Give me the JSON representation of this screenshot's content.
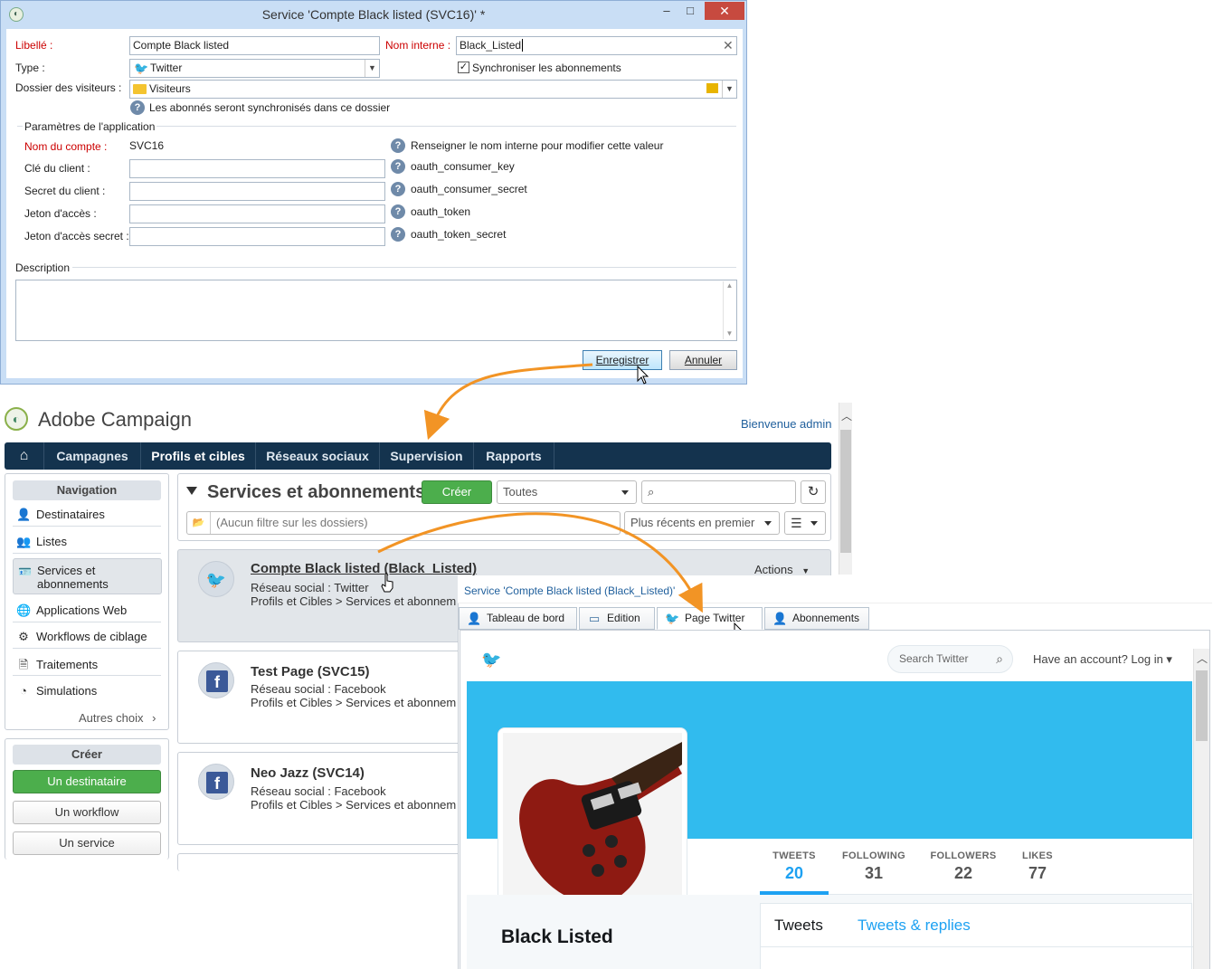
{
  "dialog": {
    "title": "Service 'Compte Black listed (SVC16)' *",
    "win_minimize": "–",
    "win_maximize": "□",
    "win_close": "✕",
    "labels": {
      "libelle": "Libellé :",
      "nom_interne": "Nom interne :",
      "type": "Type :",
      "dossier": "Dossier des visiteurs :",
      "sync_info": "Les abonnés seront synchronisés dans ce dossier",
      "app_params": "Paramètres de l'application",
      "nom_compte": "Nom du compte :",
      "cle_client": "Clé du client :",
      "secret_client": "Secret du client :",
      "jeton": "Jeton d'accès :",
      "jeton_secret": "Jeton d'accès secret :",
      "description": "Description"
    },
    "values": {
      "libelle": "Compte Black listed",
      "nom_interne": "Black_Listed",
      "type": "Twitter",
      "dossier": "Visiteurs",
      "nom_compte": "SVC16",
      "sync_checkbox": "Synchroniser les abonnements",
      "sync_checked": true
    },
    "hints": {
      "nom_compte": "Renseigner le nom interne pour modifier cette valeur",
      "cle_client": "oauth_consumer_key",
      "secret_client": "oauth_consumer_secret",
      "jeton": "oauth_token",
      "jeton_secret": "oauth_token_secret"
    },
    "buttons": {
      "save": "Enregistrer",
      "cancel": "Annuler"
    }
  },
  "campaign": {
    "brand": "Adobe Campaign",
    "welcome": "Bienvenue admin",
    "nav": [
      "Campagnes",
      "Profils et cibles",
      "Réseaux sociaux",
      "Supervision",
      "Rapports"
    ],
    "nav_active": "Profils et cibles",
    "sidebar": {
      "nav_title": "Navigation",
      "items": [
        "Destinataires",
        "Listes",
        "Services et abonnements",
        "Applications Web",
        "Workflows de ciblage",
        "Traitements",
        "Simulations"
      ],
      "more": "Autres choix",
      "create_title": "Créer",
      "create_buttons": [
        "Un destinataire",
        "Un workflow",
        "Un service"
      ]
    },
    "main": {
      "title": "Services et abonnements",
      "create": "Créer",
      "filter_select": "Toutes",
      "folder_filter": "(Aucun filtre sur les dossiers)",
      "sort": "Plus récents en premier",
      "cards": [
        {
          "title": "Compte Black listed (Black_Listed)",
          "line1": "Réseau social : Twitter",
          "line2": "Profils et Cibles > Services et abonnem",
          "actions": "Actions"
        },
        {
          "title": "Test Page (SVC15)",
          "line1": "Réseau social : Facebook",
          "line2": "Profils et Cibles > Services et abonnem"
        },
        {
          "title": "Neo Jazz (SVC14)",
          "line1": "Réseau social : Facebook",
          "line2": "Profils et Cibles > Services et abonnem"
        }
      ]
    }
  },
  "service_view": {
    "breadcrumb": "Service 'Compte Black listed (Black_Listed)'",
    "tabs": [
      "Tableau de bord",
      "Edition",
      "Page Twitter",
      "Abonnements"
    ],
    "active_tab": "Page Twitter",
    "twitter": {
      "search_placeholder": "Search Twitter",
      "login": "Have an account? Log in ▾",
      "stats": [
        {
          "label": "TWEETS",
          "value": "20"
        },
        {
          "label": "FOLLOWING",
          "value": "31"
        },
        {
          "label": "FOLLOWERS",
          "value": "22"
        },
        {
          "label": "LIKES",
          "value": "77"
        }
      ],
      "profile_name": "Black Listed",
      "tab_tweets": "Tweets",
      "tab_replies": "Tweets & replies",
      "banner_color": "#31bbee",
      "accent_color": "#1da1f2"
    }
  }
}
